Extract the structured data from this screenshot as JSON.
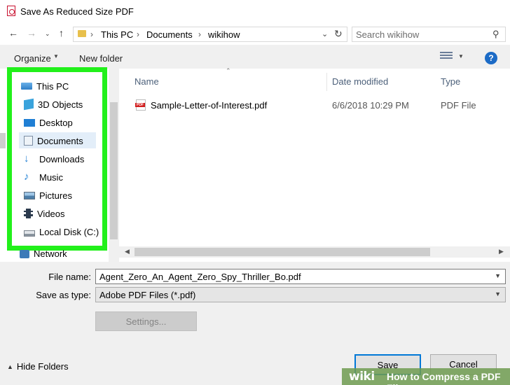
{
  "window": {
    "title": "Save As Reduced Size PDF"
  },
  "address": {
    "crumbs": [
      "This PC",
      "Documents",
      "wikihow"
    ],
    "search_placeholder": "Search wikihow"
  },
  "toolbar": {
    "organize": "Organize",
    "new_folder": "New folder",
    "help": "?"
  },
  "nav": {
    "items": [
      {
        "label": "This PC",
        "icon": "computer-icon"
      },
      {
        "label": "3D Objects",
        "icon": "cube-icon"
      },
      {
        "label": "Desktop",
        "icon": "desktop-icon"
      },
      {
        "label": "Documents",
        "icon": "document-icon"
      },
      {
        "label": "Downloads",
        "icon": "download-arrow-icon"
      },
      {
        "label": "Music",
        "icon": "music-note-icon"
      },
      {
        "label": "Pictures",
        "icon": "picture-icon"
      },
      {
        "label": "Videos",
        "icon": "film-icon"
      },
      {
        "label": "Local Disk (C:)",
        "icon": "disk-drive-icon"
      }
    ],
    "network": "Network",
    "selected": "Documents"
  },
  "files": {
    "columns": [
      "Name",
      "Date modified",
      "Type"
    ],
    "rows": [
      {
        "name": "Sample-Letter-of-Interest.pdf",
        "date": "6/6/2018 10:29 PM",
        "type": "PDF File"
      }
    ]
  },
  "form": {
    "file_name_label": "File name:",
    "file_name_value": "Agent_Zero_An_Agent_Zero_Spy_Thriller_Bo.pdf",
    "save_type_label": "Save as type:",
    "save_type_value": "Adobe PDF Files (*.pdf)",
    "settings": "Settings..."
  },
  "footer": {
    "hide_folders": "Hide Folders",
    "save": "Save",
    "cancel": "Cancel"
  },
  "watermark": {
    "brand": "wiki",
    "title": "How to Compress a PDF File"
  },
  "colors": {
    "highlight": "#22f01b",
    "accent": "#0078d7",
    "pdf_red": "#d21f1f"
  }
}
